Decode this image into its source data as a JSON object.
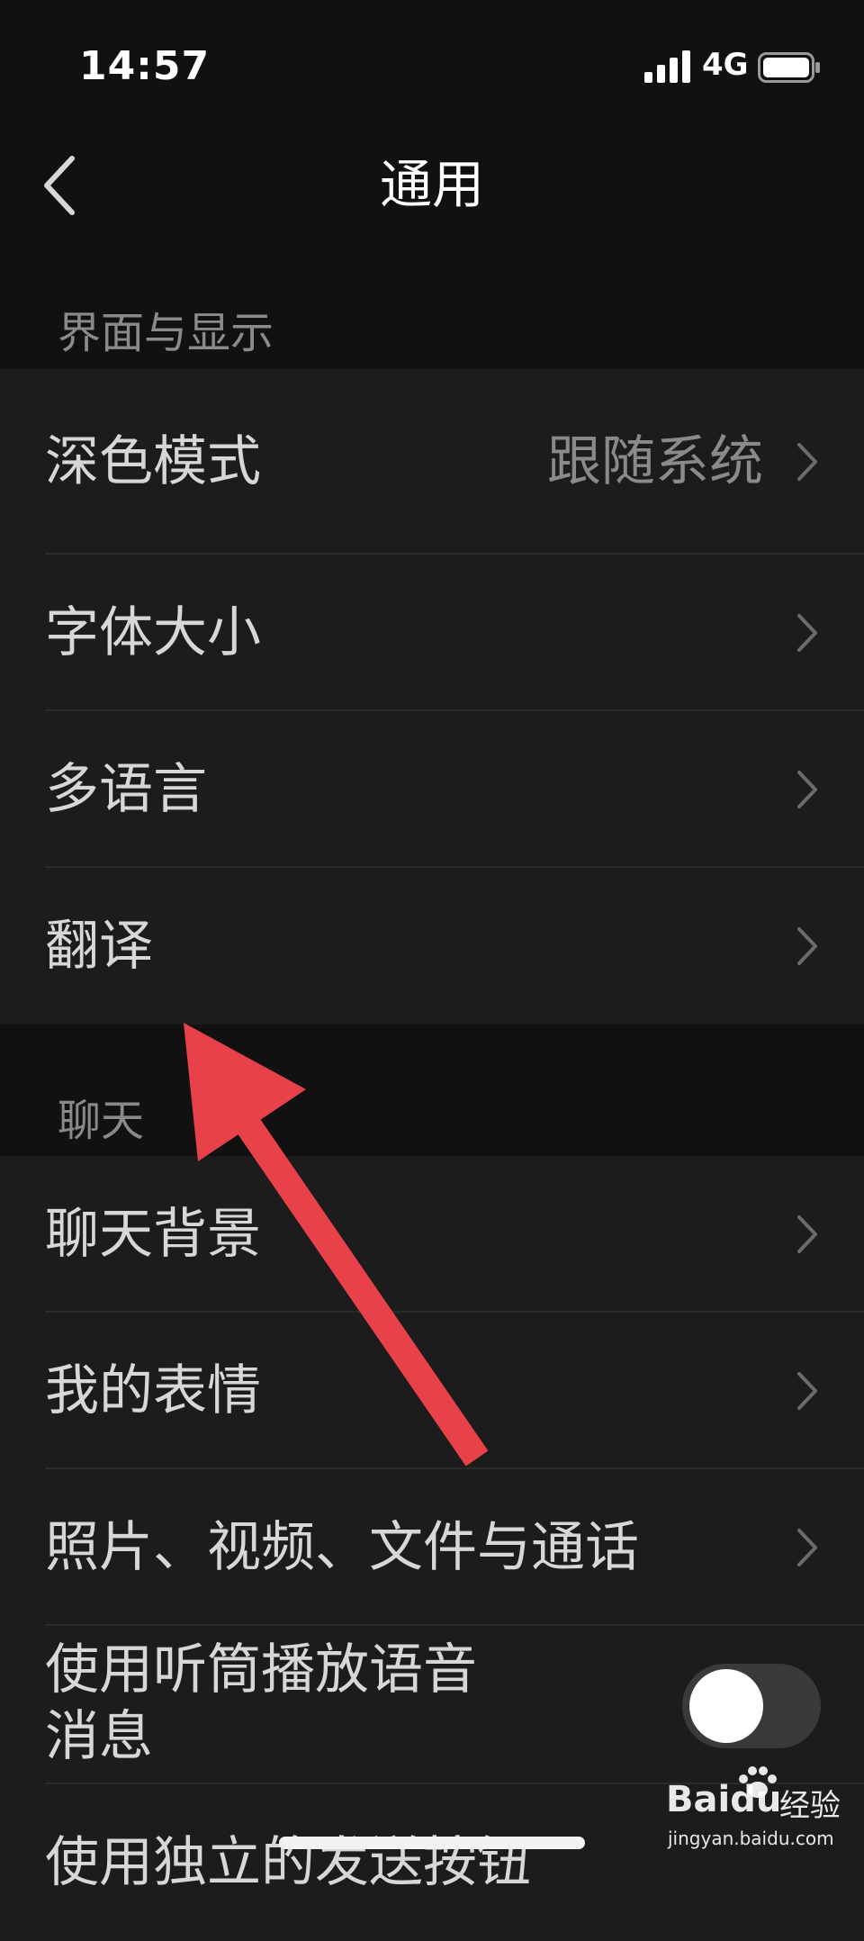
{
  "status_bar": {
    "time": "14:57",
    "network": "4G",
    "signal_icon": "signal-bars-icon",
    "battery_icon": "battery-icon"
  },
  "nav": {
    "back_icon": "chevron-left-icon",
    "title": "通用"
  },
  "sections": [
    {
      "header": "界面与显示",
      "items": [
        {
          "label": "深色模式",
          "value": "跟随系统"
        },
        {
          "label": "字体大小"
        },
        {
          "label": "多语言"
        },
        {
          "label": "翻译"
        }
      ]
    },
    {
      "header": "聊天",
      "items": [
        {
          "label": "聊天背景"
        },
        {
          "label": "我的表情"
        },
        {
          "label": "照片、视频、文件与通话"
        },
        {
          "label": "使用听筒播放语音消息",
          "label_line1": "使用听筒播放语音",
          "label_line2": "消息",
          "toggle": false
        },
        {
          "label": "使用独立的发送按钮"
        }
      ]
    }
  ],
  "annotation": {
    "type": "arrow-icon",
    "color": "#e8414a"
  },
  "watermark": {
    "brand_left": "Bai",
    "brand_right": "du",
    "brand_suffix": "经验",
    "url": "jingyan.baidu.com"
  },
  "colors": {
    "background": "#111111",
    "group_background": "#1c1c1c",
    "primary_text": "#d7d7d7",
    "secondary_text": "#8a8a8a",
    "toggle_off": "#3a3a3c"
  }
}
